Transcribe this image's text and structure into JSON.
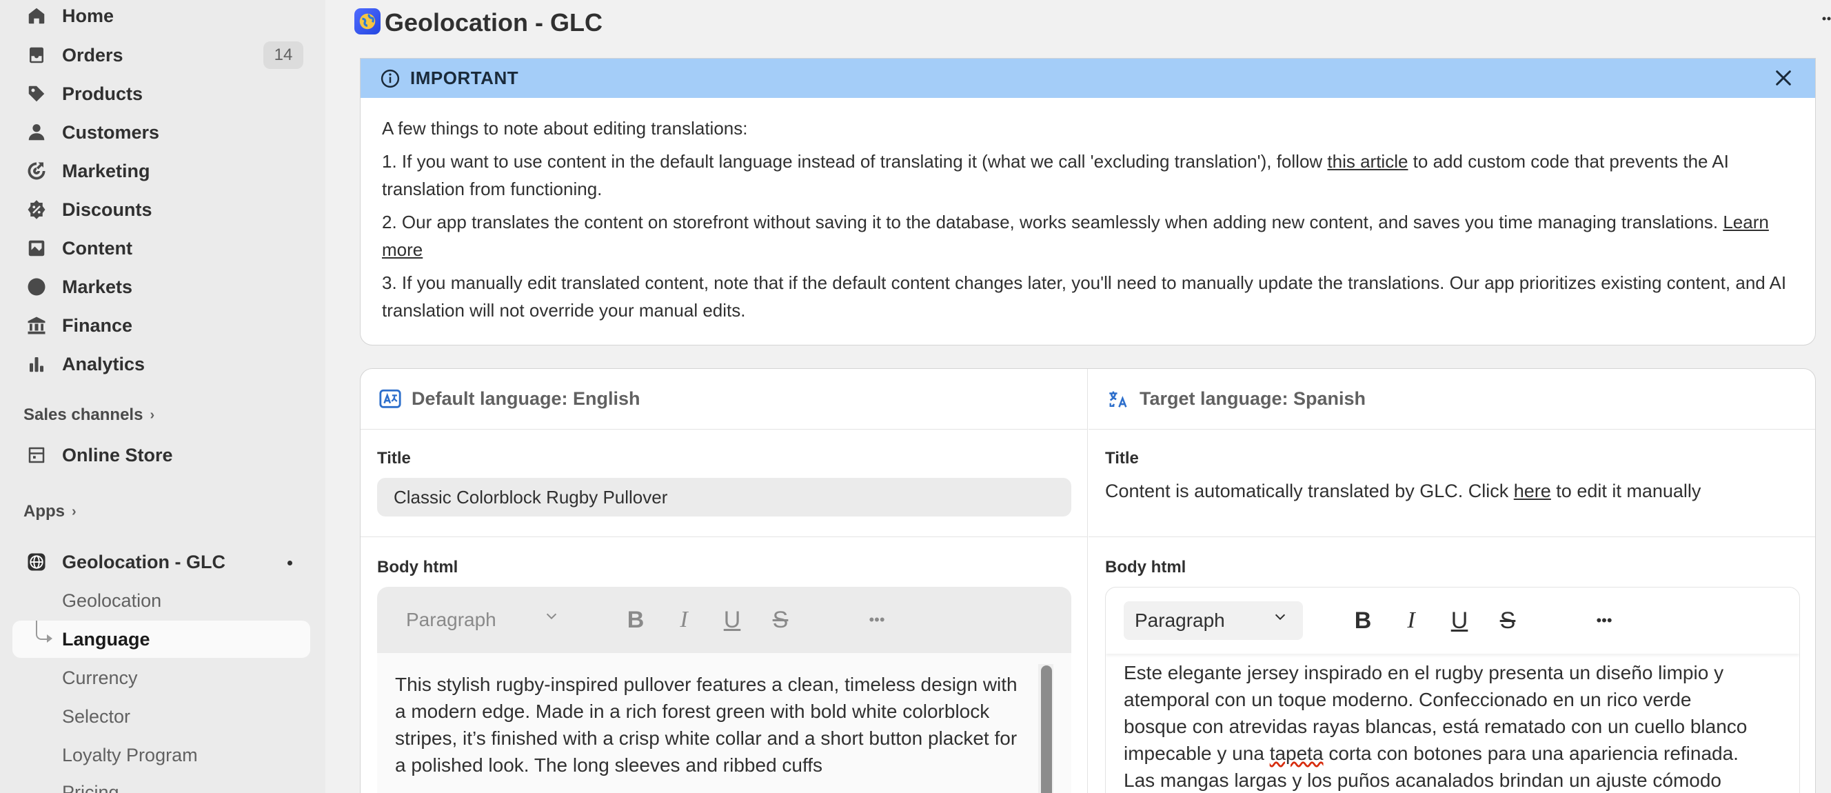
{
  "sidebar": {
    "items": [
      {
        "label": "Home",
        "icon": "home-icon"
      },
      {
        "label": "Orders",
        "icon": "orders-icon",
        "count": "14"
      },
      {
        "label": "Products",
        "icon": "tag-icon"
      },
      {
        "label": "Customers",
        "icon": "person-icon"
      },
      {
        "label": "Marketing",
        "icon": "target-icon"
      },
      {
        "label": "Discounts",
        "icon": "discount-icon"
      },
      {
        "label": "Content",
        "icon": "image-icon"
      },
      {
        "label": "Markets",
        "icon": "globe-icon"
      },
      {
        "label": "Finance",
        "icon": "bank-icon"
      },
      {
        "label": "Analytics",
        "icon": "chart-bar-icon"
      }
    ],
    "sales_channels_label": "Sales channels",
    "online_store_label": "Online Store",
    "apps_label": "Apps",
    "app_label": "Geolocation - GLC",
    "app_subitems": [
      "Geolocation",
      "Language",
      "Currency",
      "Selector",
      "Loyalty Program",
      "Pricing"
    ]
  },
  "header": {
    "title": "Geolocation - GLC"
  },
  "banner": {
    "title": "IMPORTANT",
    "intro": "A few things to note about editing translations:",
    "p1_before": "1. If you want to use content in the default language instead of translating it (what we call 'excluding translation'), follow ",
    "p1_link": "this article",
    "p1_after": " to add custom code that prevents the AI translation from functioning.",
    "p2_before": "2. Our app translates the content on storefront without saving it to the database, works seamlessly when adding new content, and saves you time managing translations. ",
    "p2_link": "Learn more",
    "p3": "3. If you manually edit translated content, note that if the default content changes later, you'll need to manually update the translations. Our app prioritizes existing content, and AI translation will not override your manual edits."
  },
  "editor": {
    "default_heading": "Default language: English",
    "target_heading": "Target language: Spanish",
    "title_label": "Title",
    "title_value": "Classic Colorblock Rugby Pullover",
    "auto_before": "Content is automatically translated by GLC. Click ",
    "auto_link": "here",
    "auto_after": " to edit it manually",
    "body_label": "Body html",
    "paragraph_label": "Paragraph",
    "toolbar": {
      "bold": "B",
      "italic": "I",
      "underline": "U",
      "strike": "S",
      "more": "•••"
    },
    "left_body": "This stylish rugby-inspired pullover features a clean, timeless design with a modern edge. Made in a rich forest green with bold white colorblock stripes, it’s finished with a crisp white collar and a short button placket for a polished look. The long sleeves and ribbed cuffs",
    "right_body_1": "Este elegante jersey inspirado en el rugby presenta un diseño limpio y atemporal con un toque moderno. Confeccionado en un rico verde bosque con atrevidas rayas blancas, está rematado con un cuello blanco impecable y una ",
    "right_body_spell": "tapeta",
    "right_body_2": " corta con botones para una apariencia refinada. Las mangas largas y los puños acanalados brindan un ajuste cómodo"
  }
}
